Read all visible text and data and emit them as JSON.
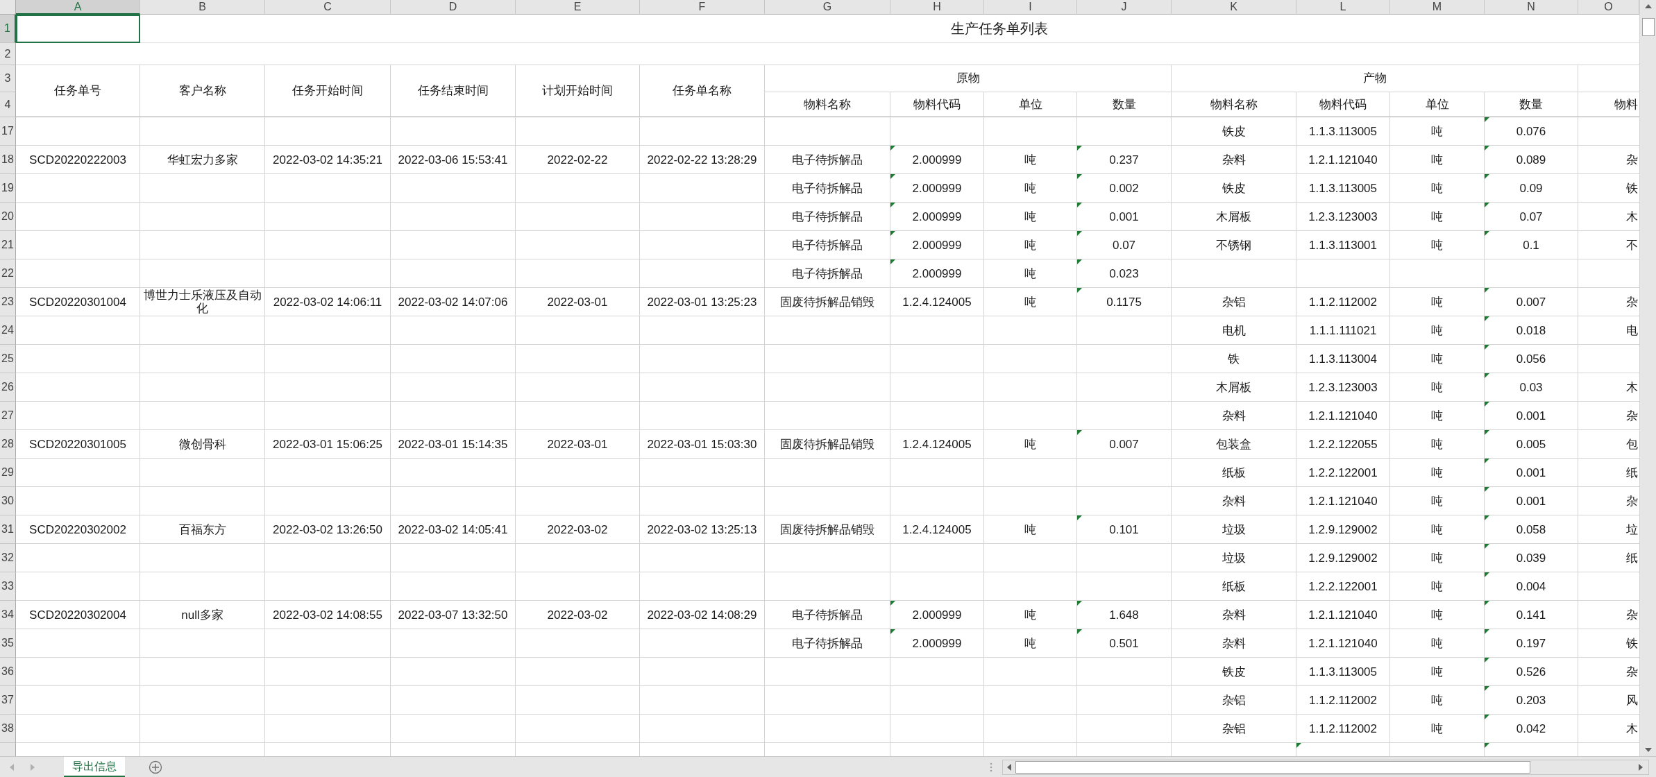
{
  "columns": [
    {
      "letter": "A",
      "selected": true
    },
    {
      "letter": "B",
      "selected": false
    },
    {
      "letter": "C",
      "selected": false
    },
    {
      "letter": "D",
      "selected": false
    },
    {
      "letter": "E",
      "selected": false
    },
    {
      "letter": "F",
      "selected": false
    },
    {
      "letter": "G",
      "selected": false
    },
    {
      "letter": "H",
      "selected": false
    },
    {
      "letter": "I",
      "selected": false
    },
    {
      "letter": "J",
      "selected": false
    },
    {
      "letter": "K",
      "selected": false
    },
    {
      "letter": "L",
      "selected": false
    },
    {
      "letter": "M",
      "selected": false
    },
    {
      "letter": "N",
      "selected": false
    },
    {
      "letter": "O",
      "selected": false
    }
  ],
  "top_rows": [
    {
      "number": "1",
      "selected": true
    },
    {
      "number": "2",
      "selected": false
    },
    {
      "number": "3",
      "selected": false
    },
    {
      "number": "4",
      "selected": false
    }
  ],
  "sheet_title": "生产任务单列表",
  "header": {
    "main": [
      "任务单号",
      "客户名称",
      "任务开始时间",
      "任务结束时间",
      "计划开始时间",
      "任务单名称"
    ],
    "groups": [
      {
        "label": "原物",
        "columns": [
          "物料名称",
          "物料代码",
          "单位",
          "数量"
        ]
      },
      {
        "label": "产物",
        "columns": [
          "物料名称",
          "物料代码",
          "单位",
          "数量"
        ]
      }
    ],
    "column_15": "物料"
  },
  "rows": [
    {
      "number": "17",
      "cells": {
        "K": "铁皮",
        "L": "1.1.3.113005",
        "M": "吨",
        "N": "0.076"
      },
      "flags": {
        "h": false,
        "j": false,
        "l": false,
        "n": true
      }
    },
    {
      "number": "18",
      "cells": {
        "A": "SCD20220222003",
        "B": "华虹宏力多家",
        "C": "2022-03-02 14:35:21",
        "D": "2022-03-06 15:53:41",
        "E": "2022-02-22",
        "F": "2022-02-22 13:28:29",
        "G": "电子待拆解品",
        "H": "2.000999",
        "I": "吨",
        "J": "0.237",
        "K": "杂料",
        "L": "1.2.1.121040",
        "M": "吨",
        "N": "0.089",
        "O": "杂"
      },
      "flags": {
        "h": true,
        "j": true,
        "l": false,
        "n": true
      }
    },
    {
      "number": "19",
      "cells": {
        "G": "电子待拆解品",
        "H": "2.000999",
        "I": "吨",
        "J": "0.002",
        "K": "铁皮",
        "L": "1.1.3.113005",
        "M": "吨",
        "N": "0.09",
        "O": "铁"
      },
      "flags": {
        "h": true,
        "j": true,
        "l": false,
        "n": true
      }
    },
    {
      "number": "20",
      "cells": {
        "G": "电子待拆解品",
        "H": "2.000999",
        "I": "吨",
        "J": "0.001",
        "K": "木屑板",
        "L": "1.2.3.123003",
        "M": "吨",
        "N": "0.07",
        "O": "木"
      },
      "flags": {
        "h": true,
        "j": true,
        "l": false,
        "n": true
      }
    },
    {
      "number": "21",
      "cells": {
        "G": "电子待拆解品",
        "H": "2.000999",
        "I": "吨",
        "J": "0.07",
        "K": "不锈钢",
        "L": "1.1.3.113001",
        "M": "吨",
        "N": "0.1",
        "O": "不"
      },
      "flags": {
        "h": true,
        "j": true,
        "l": false,
        "n": true
      }
    },
    {
      "number": "22",
      "cells": {
        "G": "电子待拆解品",
        "H": "2.000999",
        "I": "吨",
        "J": "0.023"
      },
      "flags": {
        "h": true,
        "j": true,
        "l": false,
        "n": false
      }
    },
    {
      "number": "23",
      "cells": {
        "A": "SCD20220301004",
        "B": "博世力士乐液压及自动化",
        "C": "2022-03-02 14:06:11",
        "D": "2022-03-02 14:07:06",
        "E": "2022-03-01",
        "F": "2022-03-01 13:25:23",
        "G": "固废待拆解品销毁",
        "H": "1.2.4.124005",
        "I": "吨",
        "J": "0.1175",
        "K": "杂铝",
        "L": "1.1.2.112002",
        "M": "吨",
        "N": "0.007",
        "O": "杂"
      },
      "flags": {
        "h": false,
        "j": true,
        "l": false,
        "n": true
      }
    },
    {
      "number": "24",
      "cells": {
        "K": "电机",
        "L": "1.1.1.111021",
        "M": "吨",
        "N": "0.018",
        "O": "电"
      },
      "flags": {
        "h": false,
        "j": false,
        "l": false,
        "n": true
      }
    },
    {
      "number": "25",
      "cells": {
        "K": "铁",
        "L": "1.1.3.113004",
        "M": "吨",
        "N": "0.056"
      },
      "flags": {
        "h": false,
        "j": false,
        "l": false,
        "n": true
      }
    },
    {
      "number": "26",
      "cells": {
        "K": "木屑板",
        "L": "1.2.3.123003",
        "M": "吨",
        "N": "0.03",
        "O": "木"
      },
      "flags": {
        "h": false,
        "j": false,
        "l": false,
        "n": true
      }
    },
    {
      "number": "27",
      "cells": {
        "K": "杂料",
        "L": "1.2.1.121040",
        "M": "吨",
        "N": "0.001",
        "O": "杂"
      },
      "flags": {
        "h": false,
        "j": false,
        "l": false,
        "n": true
      }
    },
    {
      "number": "28",
      "cells": {
        "A": "SCD20220301005",
        "B": "微创骨科",
        "C": "2022-03-01 15:06:25",
        "D": "2022-03-01 15:14:35",
        "E": "2022-03-01",
        "F": "2022-03-01 15:03:30",
        "G": "固废待拆解品销毁",
        "H": "1.2.4.124005",
        "I": "吨",
        "J": "0.007",
        "K": "包装盒",
        "L": "1.2.2.122055",
        "M": "吨",
        "N": "0.005",
        "O": "包"
      },
      "flags": {
        "h": false,
        "j": true,
        "l": false,
        "n": true
      }
    },
    {
      "number": "29",
      "cells": {
        "K": "纸板",
        "L": "1.2.2.122001",
        "M": "吨",
        "N": "0.001",
        "O": "纸"
      },
      "flags": {
        "h": false,
        "j": false,
        "l": false,
        "n": true
      }
    },
    {
      "number": "30",
      "cells": {
        "K": "杂料",
        "L": "1.2.1.121040",
        "M": "吨",
        "N": "0.001",
        "O": "杂"
      },
      "flags": {
        "h": false,
        "j": false,
        "l": false,
        "n": true
      }
    },
    {
      "number": "31",
      "cells": {
        "A": "SCD20220302002",
        "B": "百福东方",
        "C": "2022-03-02 13:26:50",
        "D": "2022-03-02 14:05:41",
        "E": "2022-03-02",
        "F": "2022-03-02 13:25:13",
        "G": "固废待拆解品销毁",
        "H": "1.2.4.124005",
        "I": "吨",
        "J": "0.101",
        "K": "垃圾",
        "L": "1.2.9.129002",
        "M": "吨",
        "N": "0.058",
        "O": "垃"
      },
      "flags": {
        "h": false,
        "j": true,
        "l": false,
        "n": true
      }
    },
    {
      "number": "32",
      "cells": {
        "K": "垃圾",
        "L": "1.2.9.129002",
        "M": "吨",
        "N": "0.039",
        "O": "纸"
      },
      "flags": {
        "h": false,
        "j": false,
        "l": false,
        "n": true
      }
    },
    {
      "number": "33",
      "cells": {
        "K": "纸板",
        "L": "1.2.2.122001",
        "M": "吨",
        "N": "0.004"
      },
      "flags": {
        "h": false,
        "j": false,
        "l": false,
        "n": true
      }
    },
    {
      "number": "34",
      "cells": {
        "A": "SCD20220302004",
        "B": "null多家",
        "C": "2022-03-02 14:08:55",
        "D": "2022-03-07 13:32:50",
        "E": "2022-03-02",
        "F": "2022-03-02 14:08:29",
        "G": "电子待拆解品",
        "H": "2.000999",
        "I": "吨",
        "J": "1.648",
        "K": "杂料",
        "L": "1.2.1.121040",
        "M": "吨",
        "N": "0.141",
        "O": "杂"
      },
      "flags": {
        "h": true,
        "j": true,
        "l": false,
        "n": true
      }
    },
    {
      "number": "35",
      "cells": {
        "G": "电子待拆解品",
        "H": "2.000999",
        "I": "吨",
        "J": "0.501",
        "K": "杂料",
        "L": "1.2.1.121040",
        "M": "吨",
        "N": "0.197",
        "O": "铁"
      },
      "flags": {
        "h": true,
        "j": true,
        "l": false,
        "n": true
      }
    },
    {
      "number": "36",
      "cells": {
        "K": "铁皮",
        "L": "1.1.3.113005",
        "M": "吨",
        "N": "0.526",
        "O": "杂"
      },
      "flags": {
        "h": false,
        "j": false,
        "l": false,
        "n": true
      }
    },
    {
      "number": "37",
      "cells": {
        "K": "杂铝",
        "L": "1.1.2.112002",
        "M": "吨",
        "N": "0.203",
        "O": "风"
      },
      "flags": {
        "h": false,
        "j": false,
        "l": false,
        "n": true
      }
    },
    {
      "number": "38",
      "cells": {
        "K": "杂铝",
        "L": "1.1.2.112002",
        "M": "吨",
        "N": "0.042",
        "O": "木"
      },
      "flags": {
        "h": false,
        "j": false,
        "l": false,
        "n": true
      }
    },
    {
      "cells": {},
      "flags": {
        "h": false,
        "j": false,
        "l": true,
        "n": true
      }
    }
  ],
  "sheet_tabs": [
    {
      "label": "导出信息",
      "selected": true
    }
  ]
}
